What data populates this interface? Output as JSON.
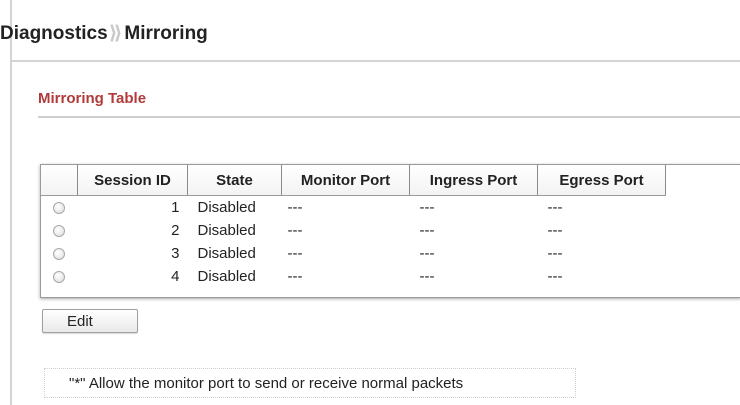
{
  "breadcrumb": {
    "parent": "Diagnostics",
    "separator": "⟫",
    "current": "Mirroring"
  },
  "section": {
    "title": "Mirroring Table"
  },
  "table": {
    "headers": [
      "Session ID",
      "State",
      "Monitor Port",
      "Ingress Port",
      "Egress Port"
    ],
    "rows": [
      {
        "session_id": "1",
        "state": "Disabled",
        "monitor_port": "---",
        "ingress_port": "---",
        "egress_port": "---"
      },
      {
        "session_id": "2",
        "state": "Disabled",
        "monitor_port": "---",
        "ingress_port": "---",
        "egress_port": "---"
      },
      {
        "session_id": "3",
        "state": "Disabled",
        "monitor_port": "---",
        "ingress_port": "---",
        "egress_port": "---"
      },
      {
        "session_id": "4",
        "state": "Disabled",
        "monitor_port": "---",
        "ingress_port": "---",
        "egress_port": "---"
      }
    ]
  },
  "buttons": {
    "edit": "Edit"
  },
  "note": {
    "text": "\"*\" Allow the monitor port to send or receive normal packets"
  },
  "colors": {
    "section_title": "#b23a3a",
    "rule": "#d4d4d4"
  }
}
